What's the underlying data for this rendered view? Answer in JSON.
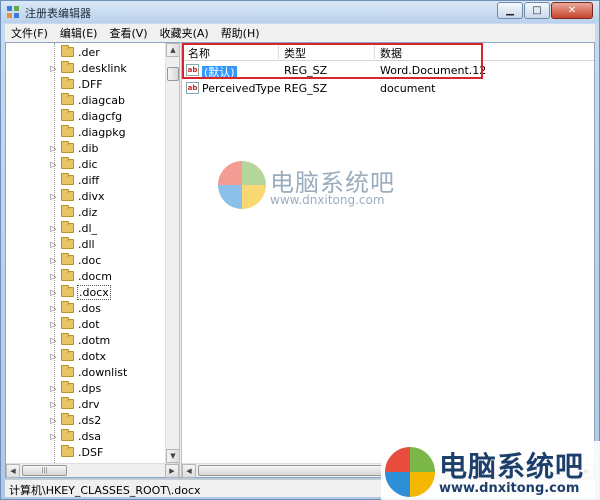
{
  "window": {
    "title": "注册表编辑器",
    "icon": "registry-editor-icon"
  },
  "menu": [
    "文件(F)",
    "编辑(E)",
    "查看(V)",
    "收藏夹(A)",
    "帮助(H)"
  ],
  "tree": {
    "items": [
      {
        "label": ".der",
        "expander": false
      },
      {
        "label": ".desklink",
        "expander": true
      },
      {
        "label": ".DFF",
        "expander": false
      },
      {
        "label": ".diagcab",
        "expander": false
      },
      {
        "label": ".diagcfg",
        "expander": false
      },
      {
        "label": ".diagpkg",
        "expander": false
      },
      {
        "label": ".dib",
        "expander": true
      },
      {
        "label": ".dic",
        "expander": true
      },
      {
        "label": ".diff",
        "expander": false
      },
      {
        "label": ".divx",
        "expander": true
      },
      {
        "label": ".diz",
        "expander": false
      },
      {
        "label": ".dl_",
        "expander": true
      },
      {
        "label": ".dll",
        "expander": true
      },
      {
        "label": ".doc",
        "expander": true
      },
      {
        "label": ".docm",
        "expander": true
      },
      {
        "label": ".docx",
        "expander": true,
        "selected": true
      },
      {
        "label": ".dos",
        "expander": true
      },
      {
        "label": ".dot",
        "expander": true
      },
      {
        "label": ".dotm",
        "expander": true
      },
      {
        "label": ".dotx",
        "expander": true
      },
      {
        "label": ".downlist",
        "expander": false
      },
      {
        "label": ".dps",
        "expander": true
      },
      {
        "label": ".drv",
        "expander": true
      },
      {
        "label": ".ds2",
        "expander": true
      },
      {
        "label": ".dsa",
        "expander": true
      },
      {
        "label": ".DSF",
        "expander": false
      }
    ]
  },
  "list": {
    "columns": [
      "名称",
      "类型",
      "数据"
    ],
    "rows": [
      {
        "name": "(默认)",
        "type": "REG_SZ",
        "data": "Word.Document.12",
        "selected": true,
        "icon": "ab-string-icon"
      },
      {
        "name": "PerceivedType",
        "type": "REG_SZ",
        "data": "document",
        "selected": false,
        "icon": "ab-string-icon"
      }
    ]
  },
  "status": "计算机\\HKEY_CLASSES_ROOT\\.docx",
  "watermark": {
    "title": "电脑系统吧",
    "url": "www.dnxitong.com",
    "colors": [
      "#e84c3d",
      "#7ab648",
      "#2d8fd6",
      "#f5b800"
    ]
  },
  "colors": {
    "highlight_box": "#d9232f",
    "selection": "#3399ff"
  }
}
